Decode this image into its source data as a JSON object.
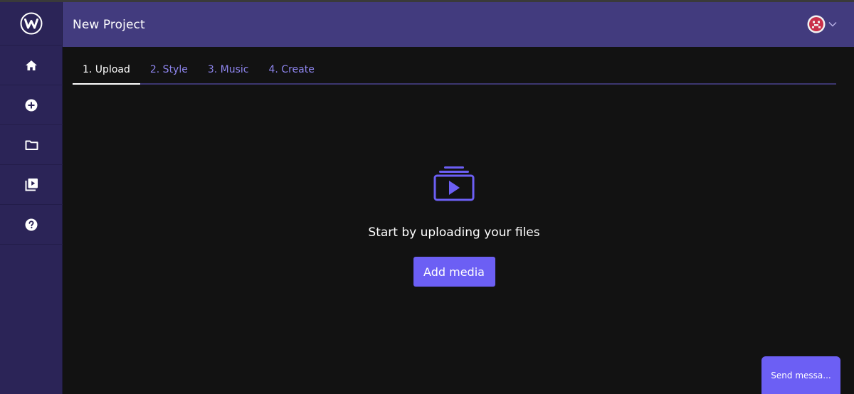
{
  "header": {
    "title": "New Project"
  },
  "tabs": [
    {
      "label": "1. Upload",
      "active": true
    },
    {
      "label": "2. Style",
      "active": false
    },
    {
      "label": "3. Music",
      "active": false
    },
    {
      "label": "4. Create",
      "active": false
    }
  ],
  "sidebar": {
    "items": [
      {
        "icon": "logo-icon"
      },
      {
        "icon": "home-icon"
      },
      {
        "icon": "add-circle-icon"
      },
      {
        "icon": "folder-icon"
      },
      {
        "icon": "video-library-icon"
      },
      {
        "icon": "help-icon"
      }
    ]
  },
  "main": {
    "prompt": "Start by uploading your files",
    "add_media_label": "Add media"
  },
  "chat": {
    "send_label": "Send messa..."
  },
  "colors": {
    "sidebar": "#2b2457",
    "header": "#423b7e",
    "accent": "#6c5ff4",
    "tab_inactive": "#8e85ee",
    "background": "#121212"
  }
}
